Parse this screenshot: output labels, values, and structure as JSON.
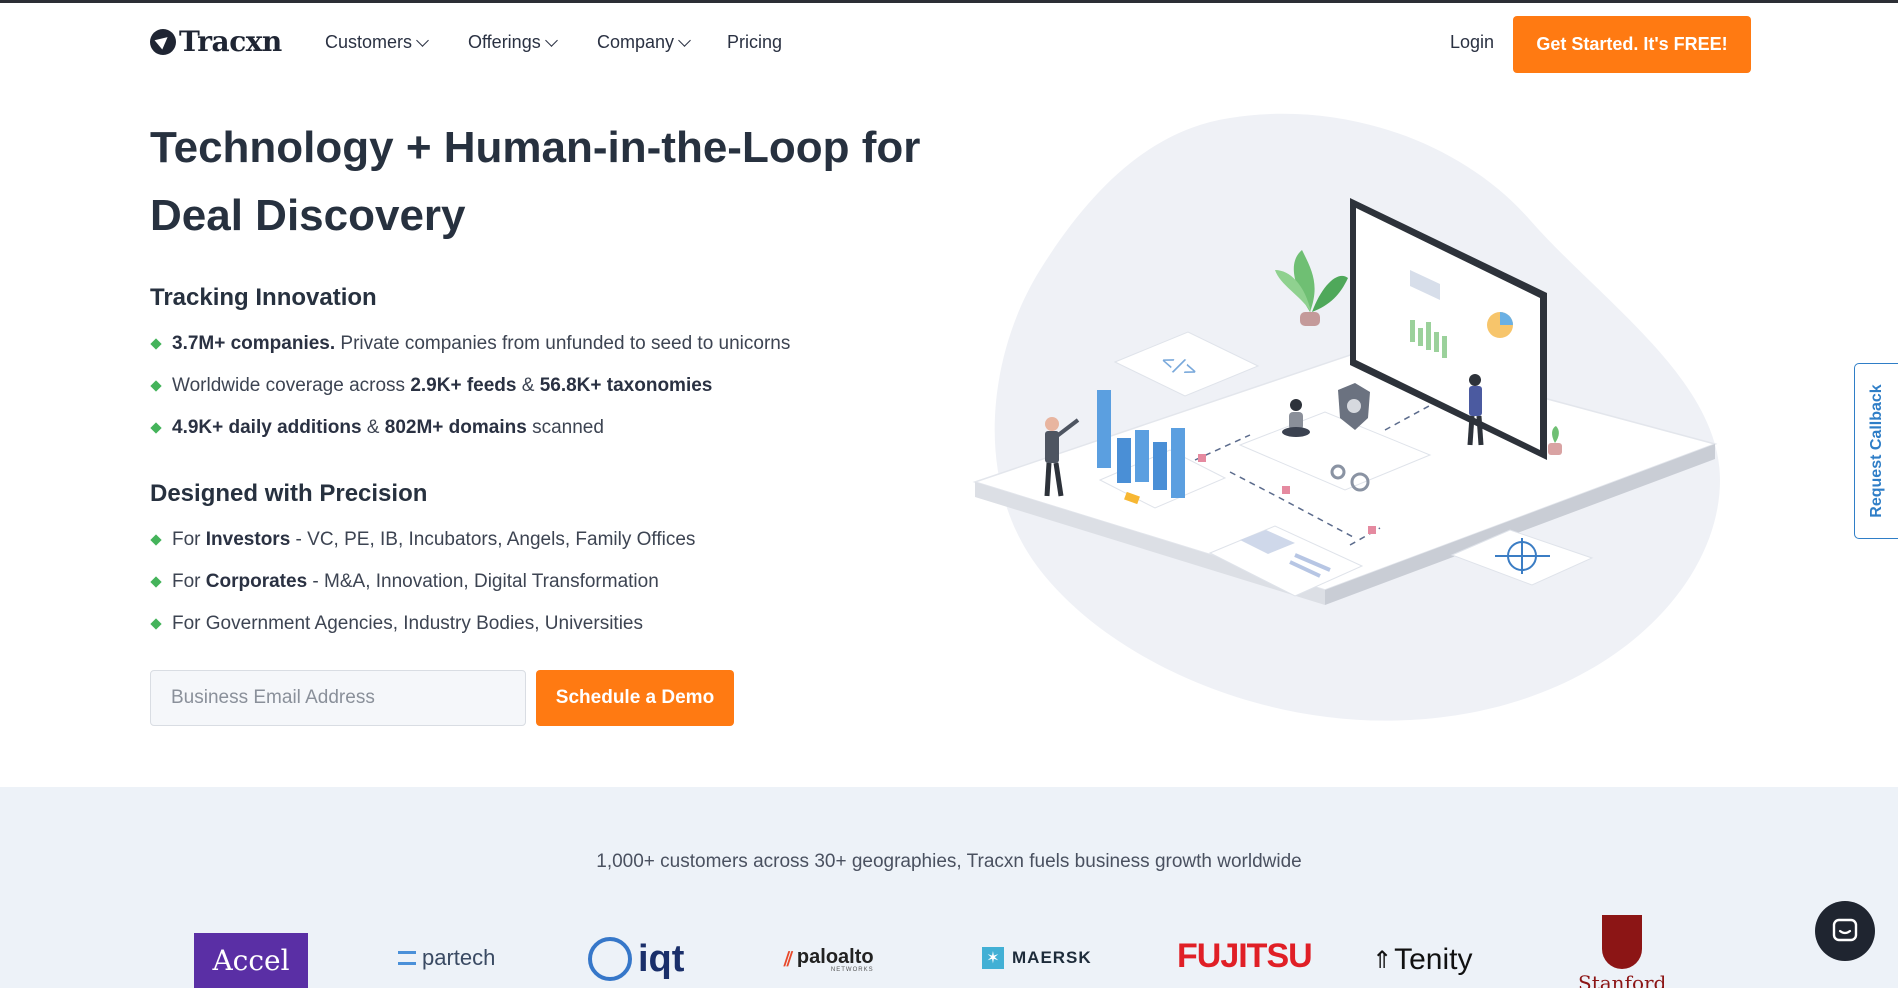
{
  "brand": {
    "name": "Tracxn",
    "accent": "#ff7a12",
    "dark": "#1f2533"
  },
  "nav": {
    "items": [
      {
        "label": "Customers",
        "dropdown": true
      },
      {
        "label": "Offerings",
        "dropdown": true
      },
      {
        "label": "Company",
        "dropdown": true
      },
      {
        "label": "Pricing",
        "dropdown": false
      }
    ],
    "login": "Login",
    "cta": "Get Started. It's FREE!"
  },
  "hero": {
    "title": "Technology + Human-in-the-Loop for Deal Discovery",
    "tracking": {
      "heading": "Tracking Innovation",
      "bullets": [
        {
          "parts": [
            {
              "b": "3.7M+ companies."
            },
            {
              "t": " Private companies from unfunded to seed to unicorns"
            }
          ]
        },
        {
          "parts": [
            {
              "t": "Worldwide coverage across "
            },
            {
              "b": "2.9K+ feeds"
            },
            {
              "t": " & "
            },
            {
              "b": "56.8K+ taxonomies"
            }
          ]
        },
        {
          "parts": [
            {
              "b": "4.9K+ daily additions"
            },
            {
              "t": " & "
            },
            {
              "b": "802M+ domains"
            },
            {
              "t": " scanned"
            }
          ]
        }
      ]
    },
    "precision": {
      "heading": "Designed with Precision",
      "bullets": [
        {
          "parts": [
            {
              "t": "For "
            },
            {
              "b": "Investors"
            },
            {
              "t": " - VC, PE, IB, Incubators, Angels, Family Offices"
            }
          ]
        },
        {
          "parts": [
            {
              "t": "For "
            },
            {
              "b": "Corporates"
            },
            {
              "t": " - M&A, Innovation, Digital Transformation"
            }
          ]
        },
        {
          "parts": [
            {
              "t": "For Government Agencies, Industry Bodies, Universities"
            }
          ]
        }
      ]
    },
    "email_placeholder": "Business Email Address",
    "demo_button": "Schedule a Demo"
  },
  "callback": "Request Callback",
  "customers": {
    "tagline": "1,000+ customers across 30+ geographies, Tracxn fuels business growth worldwide",
    "logos": [
      "Accel",
      "partech",
      "iqt",
      "paloalto",
      "MAERSK",
      "FUJITSU",
      "Tenity",
      "Stanford"
    ],
    "logo_subtexts": {
      "paloalto": "NETWORKS"
    }
  },
  "chat": {
    "icon": "chat-icon"
  }
}
